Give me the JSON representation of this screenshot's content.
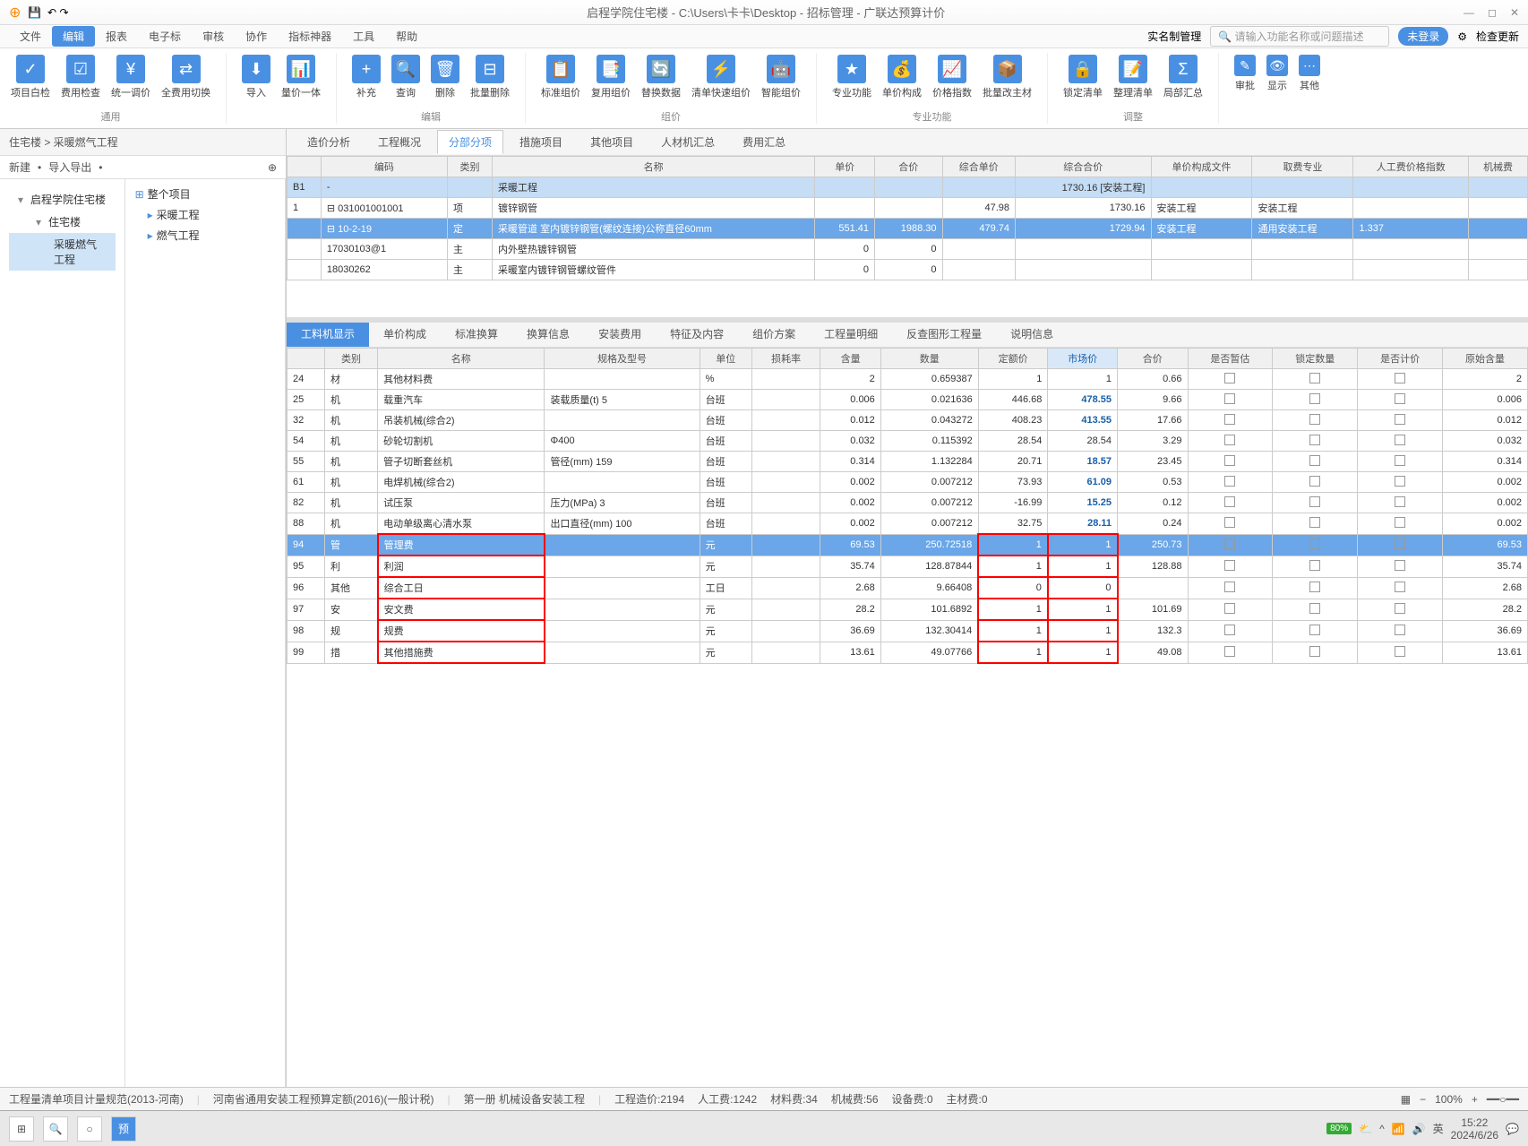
{
  "title": "启程学院住宅楼 - C:\\Users\\卡卡\\Desktop - 招标管理 - 广联达预算计价",
  "menu": [
    "文件",
    "编辑",
    "报表",
    "电子标",
    "审核",
    "协作",
    "指标神器",
    "工具",
    "帮助"
  ],
  "userMgmt": "实名制管理",
  "searchPh": "请输入功能名称或问题描述",
  "login": "未登录",
  "check": "检查更新",
  "ribbon": {
    "g1": {
      "name": "通用",
      "items": [
        "项目白检",
        "费用检查",
        "统一调价",
        "全费用切换"
      ]
    },
    "g2": {
      "name": "",
      "items": [
        "导入",
        "量价一体"
      ]
    },
    "g3": {
      "name": "编辑",
      "items": [
        "补充",
        "查询",
        "删除",
        "批量删除"
      ]
    },
    "g4": {
      "name": "组价",
      "items": [
        "标准组价",
        "复用组价",
        "替换数据",
        "清单快速组价",
        "智能组价"
      ]
    },
    "g5": {
      "name": "专业功能",
      "items": [
        "专业功能",
        "单价构成",
        "价格指数",
        "批量改主材"
      ]
    },
    "g6": {
      "name": "调整",
      "items": [
        "锁定清单",
        "整理清单",
        "局部汇总"
      ]
    },
    "g7": {
      "name": "",
      "items": [
        "审批",
        "显示",
        "其他"
      ]
    }
  },
  "breadcrumb": "住宅楼 > 采暖燃气工程",
  "leftTools": [
    "新建",
    "导入导出"
  ],
  "tree": [
    {
      "label": "启程学院住宅楼",
      "exp": "▾",
      "lv": 0
    },
    {
      "label": "住宅楼",
      "exp": "▾",
      "lv": 1
    },
    {
      "label": "采暖燃气工程",
      "lv": 2,
      "active": true
    }
  ],
  "projTree": [
    {
      "label": "整个项目",
      "ic": "⊞"
    },
    {
      "label": "采暖工程",
      "ic": "▸",
      "i": 1
    },
    {
      "label": "燃气工程",
      "ic": "▸",
      "i": 1
    }
  ],
  "rtabs": [
    "造价分析",
    "工程概况",
    "分部分项",
    "措施项目",
    "其他项目",
    "人材机汇总",
    "费用汇总"
  ],
  "rtabActive": 2,
  "mainCols": [
    "",
    "编码",
    "类别",
    "名称",
    "单价",
    "合价",
    "综合单价",
    "综合合价",
    "单价构成文件",
    "取费专业",
    "人工费价格指数",
    "机械费"
  ],
  "mainRows": [
    {
      "cells": [
        "B1",
        "-",
        "",
        "采暖工程",
        "",
        "",
        "",
        "1730.16 [安装工程]",
        "",
        "",
        "",
        ""
      ],
      "sum": true
    },
    {
      "cells": [
        "1",
        "⊟ 031001001001",
        "项",
        "镀锌钢管",
        "",
        "",
        "47.98",
        "1730.16",
        "安装工程",
        "安装工程",
        "",
        ""
      ]
    },
    {
      "cells": [
        "",
        "⊟ 10-2-19",
        "定",
        "采暖管道 室内镀锌钢管(螺纹连接)公称直径60mm",
        "551.41",
        "1988.30",
        "479.74",
        "1729.94",
        "安装工程",
        "通用安装工程",
        "1.337",
        ""
      ],
      "hl": true
    },
    {
      "cells": [
        "",
        "17030103@1",
        "主",
        "内外壁热镀锌钢管",
        "0",
        "0",
        "",
        "",
        "",
        "",
        "",
        ""
      ]
    },
    {
      "cells": [
        "",
        "18030262",
        "主",
        "采暖室内镀锌钢管螺纹管件",
        "0",
        "0",
        "",
        "",
        "",
        "",
        "",
        ""
      ]
    }
  ],
  "dtabs": [
    "工料机显示",
    "单价构成",
    "标准换算",
    "换算信息",
    "安装费用",
    "特征及内容",
    "组价方案",
    "工程量明细",
    "反查图形工程量",
    "说明信息"
  ],
  "dcols": [
    "",
    "类别",
    "名称",
    "规格及型号",
    "单位",
    "损耗率",
    "含量",
    "数量",
    "定额价",
    "市场价",
    "合价",
    "是否暂估",
    "锁定数量",
    "是否计价",
    "原始含量"
  ],
  "drows": [
    {
      "n": "24",
      "cat": "材",
      "name": "其他材料费",
      "spec": "",
      "unit": "%",
      "loss": "",
      "qty": "2",
      "dl": "0.659387",
      "dj": "1",
      "mk": "1",
      "hj": "0.66",
      "orig": "2"
    },
    {
      "n": "25",
      "cat": "机",
      "name": "载重汽车",
      "spec": "装载质量(t) 5",
      "unit": "台班",
      "loss": "",
      "qty": "0.006",
      "dl": "0.021636",
      "dj": "446.68",
      "mk": "478.55",
      "hj": "9.66",
      "orig": "0.006",
      "blue": true
    },
    {
      "n": "32",
      "cat": "机",
      "name": "吊装机械(综合2)",
      "spec": "",
      "unit": "台班",
      "loss": "",
      "qty": "0.012",
      "dl": "0.043272",
      "dj": "408.23",
      "mk": "413.55",
      "hj": "17.66",
      "orig": "0.012",
      "blue": true
    },
    {
      "n": "54",
      "cat": "机",
      "name": "砂轮切割机",
      "spec": "Φ400",
      "unit": "台班",
      "loss": "",
      "qty": "0.032",
      "dl": "0.115392",
      "dj": "28.54",
      "mk": "28.54",
      "hj": "3.29",
      "orig": "0.032"
    },
    {
      "n": "55",
      "cat": "机",
      "name": "管子切断套丝机",
      "spec": "管径(mm) 159",
      "unit": "台班",
      "loss": "",
      "qty": "0.314",
      "dl": "1.132284",
      "dj": "20.71",
      "mk": "18.57",
      "hj": "23.45",
      "orig": "0.314",
      "blue": true
    },
    {
      "n": "61",
      "cat": "机",
      "name": "电焊机械(综合2)",
      "spec": "",
      "unit": "台班",
      "loss": "",
      "qty": "0.002",
      "dl": "0.007212",
      "dj": "73.93",
      "mk": "61.09",
      "hj": "0.53",
      "orig": "0.002",
      "blue": true
    },
    {
      "n": "82",
      "cat": "机",
      "name": "试压泵",
      "spec": "压力(MPa) 3",
      "unit": "台班",
      "loss": "",
      "qty": "0.002",
      "dl": "0.007212",
      "dj": "-16.99",
      "mk": "15.25",
      "hj": "0.12",
      "orig": "0.002",
      "blue": true
    },
    {
      "n": "88",
      "cat": "机",
      "name": "电动单级离心清水泵",
      "spec": "出口直径(mm) 100",
      "unit": "台班",
      "loss": "",
      "qty": "0.002",
      "dl": "0.007212",
      "dj": "32.75",
      "mk": "28.11",
      "hj": "0.24",
      "orig": "0.002",
      "blue": true
    },
    {
      "n": "94",
      "cat": "管",
      "name": "管理费",
      "spec": "",
      "unit": "元",
      "loss": "",
      "qty": "69.53",
      "dl": "250.72518",
      "dj": "1",
      "mk": "1",
      "hj": "250.73",
      "orig": "69.53",
      "sel": true,
      "red": true
    },
    {
      "n": "95",
      "cat": "利",
      "name": "利润",
      "spec": "",
      "unit": "元",
      "loss": "",
      "qty": "35.74",
      "dl": "128.87844",
      "dj": "1",
      "mk": "1",
      "hj": "128.88",
      "orig": "35.74",
      "red": true
    },
    {
      "n": "96",
      "cat": "其他",
      "name": "综合工日",
      "spec": "",
      "unit": "工日",
      "loss": "",
      "qty": "2.68",
      "dl": "9.66408",
      "dj": "0",
      "mk": "0",
      "hj": "",
      "orig": "2.68",
      "red": true
    },
    {
      "n": "97",
      "cat": "安",
      "name": "安文费",
      "spec": "",
      "unit": "元",
      "loss": "",
      "qty": "28.2",
      "dl": "101.6892",
      "dj": "1",
      "mk": "1",
      "hj": "101.69",
      "orig": "28.2",
      "red": true
    },
    {
      "n": "98",
      "cat": "规",
      "name": "规费",
      "spec": "",
      "unit": "元",
      "loss": "",
      "qty": "36.69",
      "dl": "132.30414",
      "dj": "1",
      "mk": "1",
      "hj": "132.3",
      "orig": "36.69",
      "red": true
    },
    {
      "n": "99",
      "cat": "措",
      "name": "其他措施费",
      "spec": "",
      "unit": "元",
      "loss": "",
      "qty": "13.61",
      "dl": "49.07766",
      "dj": "1",
      "mk": "1",
      "hj": "49.08",
      "orig": "13.61",
      "red": true
    }
  ],
  "status": {
    "l1": "工程量清单项目计量规范(2013-河南)",
    "l2": "河南省通用安装工程预算定额(2016)(一般计税)",
    "l3": "第一册 机械设备安装工程",
    "price": "工程造价:2194",
    "lab": "人工费:1242",
    "mat": "材料费:34",
    "mach": "机械费:56",
    "dev": "设备费:0",
    "main": "主材费:0",
    "zoom": "100%"
  },
  "task": {
    "battery": "80%",
    "ime": "英",
    "time": "15:22",
    "date": "2024/6/26"
  }
}
